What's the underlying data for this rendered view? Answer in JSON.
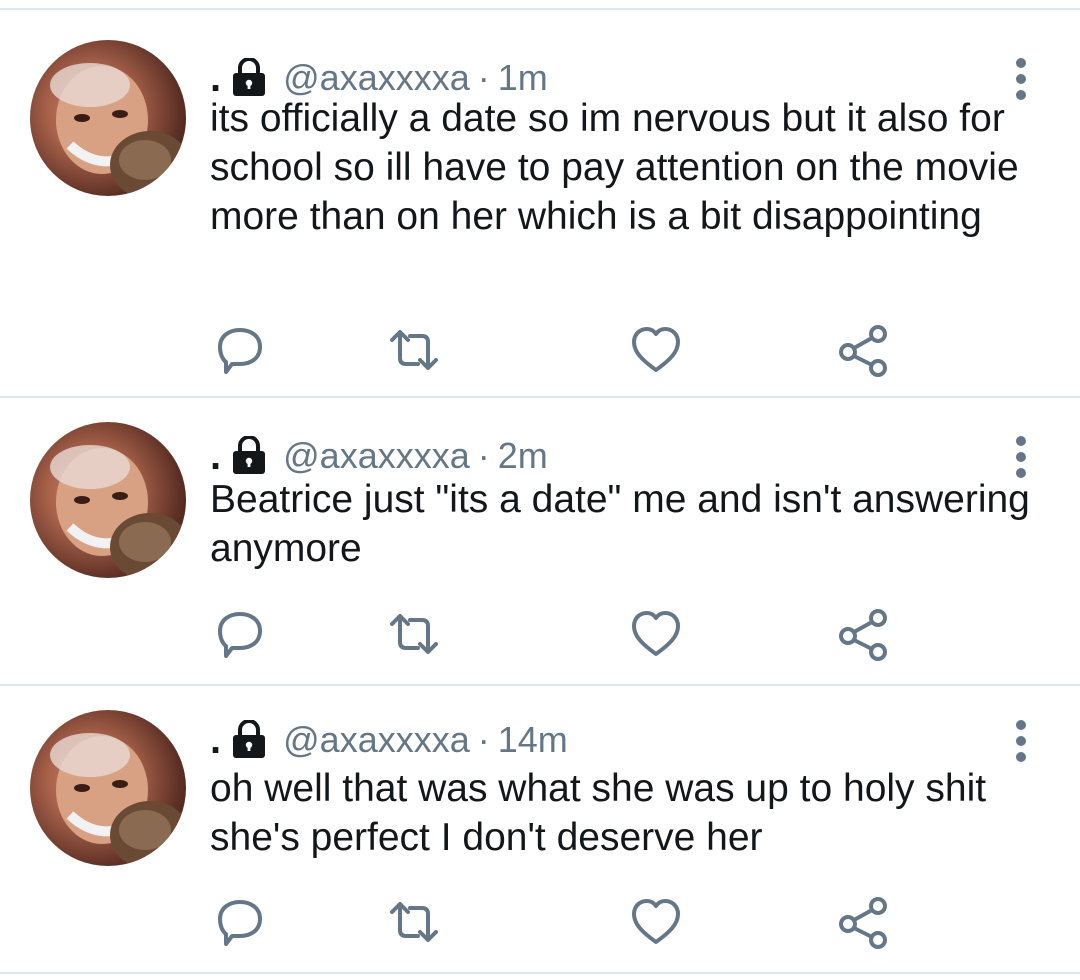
{
  "colors": {
    "text": "#14171a",
    "secondary": "#657786",
    "divider": "#e1e8ed",
    "icon": "#657786"
  },
  "tweets": [
    {
      "display_name": ".",
      "handle": "@axaxxxxa",
      "separator": "·",
      "time": "1m",
      "text": "its officially a date so im nervous but it also for school so ill have to pay attention on the movie more than on her which is a bit disappointing",
      "icons": [
        "lock-icon",
        "more-icon",
        "reply-icon",
        "retweet-icon",
        "like-icon",
        "share-icon"
      ]
    },
    {
      "display_name": ".",
      "handle": "@axaxxxxa",
      "separator": "·",
      "time": "2m",
      "text": "Beatrice just \"its a date\" me and isn't answering anymore",
      "icons": [
        "lock-icon",
        "more-icon",
        "reply-icon",
        "retweet-icon",
        "like-icon",
        "share-icon"
      ]
    },
    {
      "display_name": ".",
      "handle": "@axaxxxxa",
      "separator": "·",
      "time": "14m",
      "text": "oh well that was what she was up to holy shit she's perfect I don't deserve her",
      "icons": [
        "lock-icon",
        "more-icon",
        "reply-icon",
        "retweet-icon",
        "like-icon",
        "share-icon"
      ]
    }
  ]
}
